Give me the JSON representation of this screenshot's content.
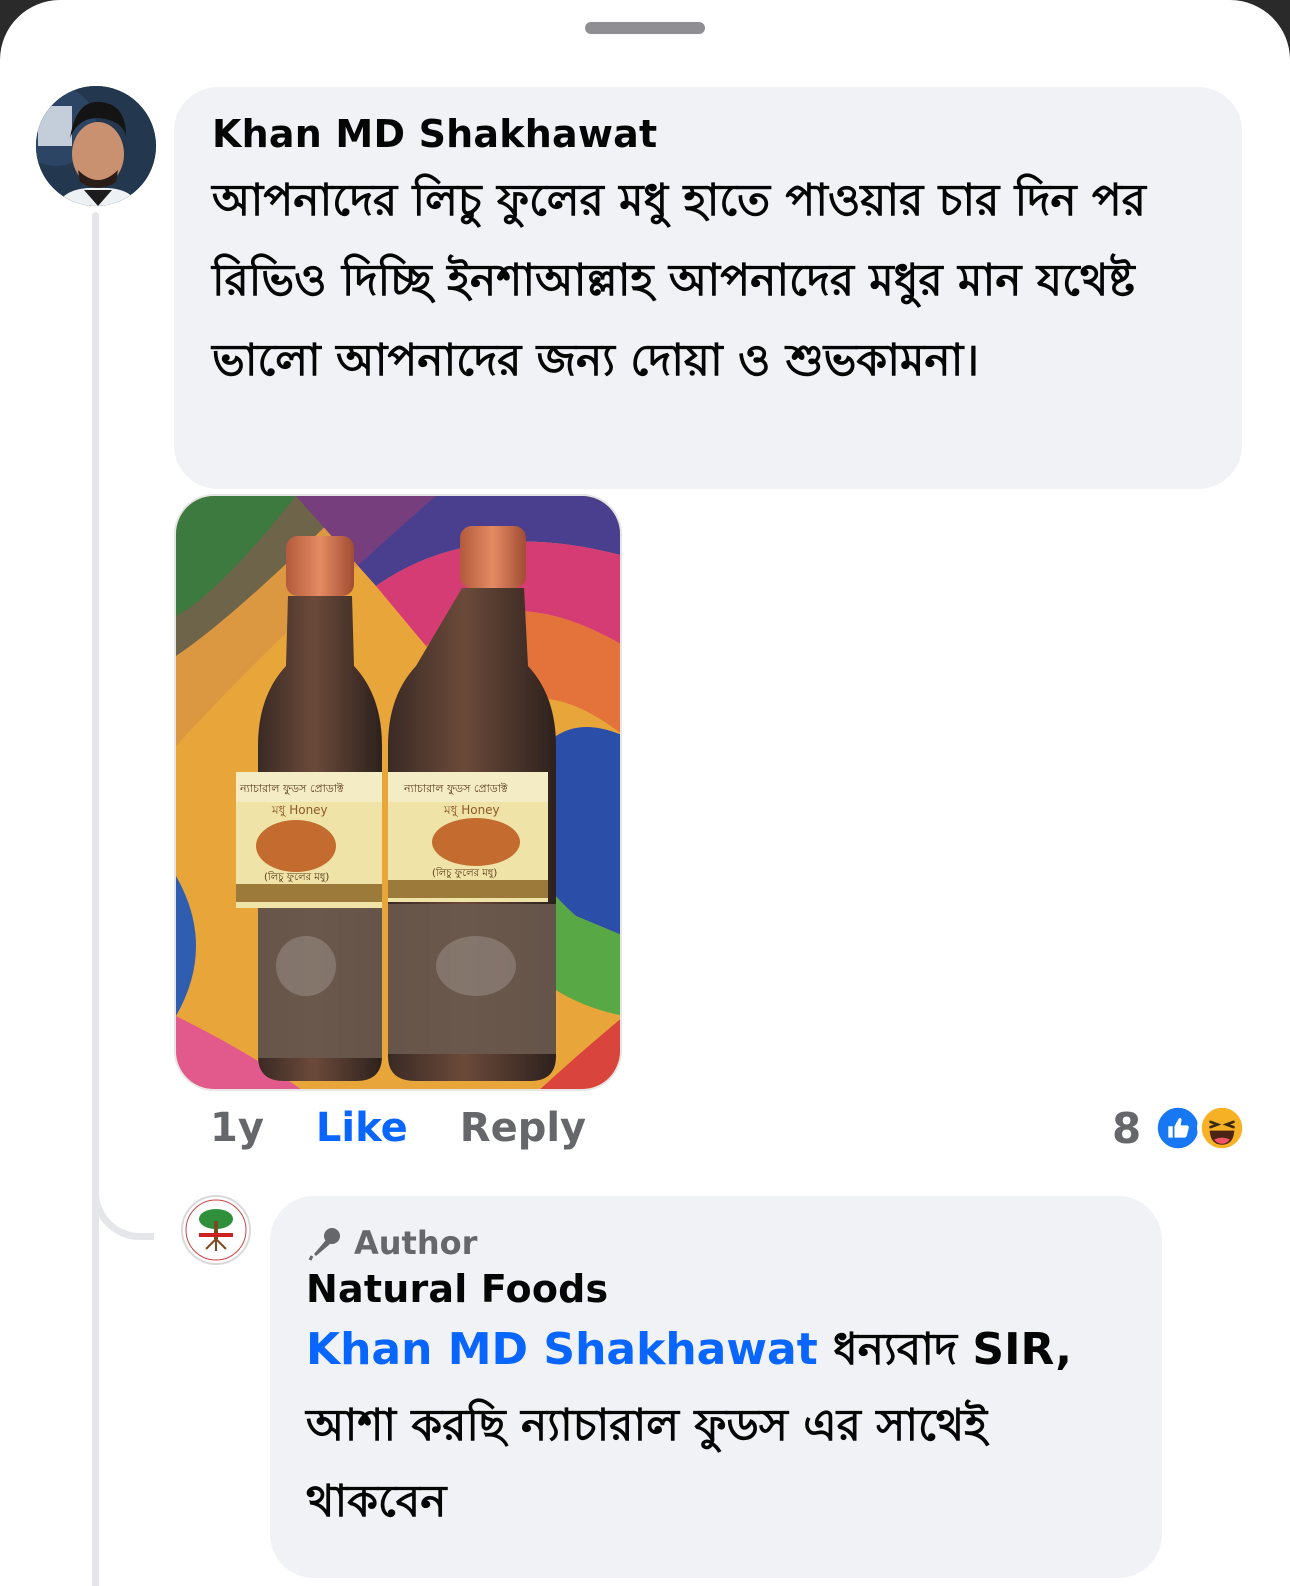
{
  "comment": {
    "author": "Khan MD Shakhawat",
    "text": "আপনাদের লিচু ফুলের মধু হাতে পাওয়ার চার দিন পর রিভিও দিচ্ছি ইনশাআল্লাহ আপনাদের মধুর মান যথেষ্ট ভালো আপনাদের জন্য দোয়া ও শুভকামনা।",
    "age": "1y",
    "like_label": "Like",
    "reply_label": "Reply",
    "reaction_count": "8",
    "reaction_icons": [
      "like-reaction-icon",
      "haha-reaction-icon"
    ],
    "photo_label_text": "ন্যাচারাল ফুডস প্রোডাক্ট",
    "photo_honey_text": "মধু Honey",
    "photo_sub_text": "(লিচু ফুলের মধু)"
  },
  "reply": {
    "badge": "Author",
    "author": "Natural Foods",
    "mention": "Khan MD Shakhawat",
    "text": " ধন্যবাদ SIR, আশা করছি ন্যাচারাল ফুডস এর সাথেই থাকবেন"
  },
  "colors": {
    "bubble": "#f0f2f5",
    "link_blue": "#0866ff",
    "secondary_text": "#65676b"
  }
}
